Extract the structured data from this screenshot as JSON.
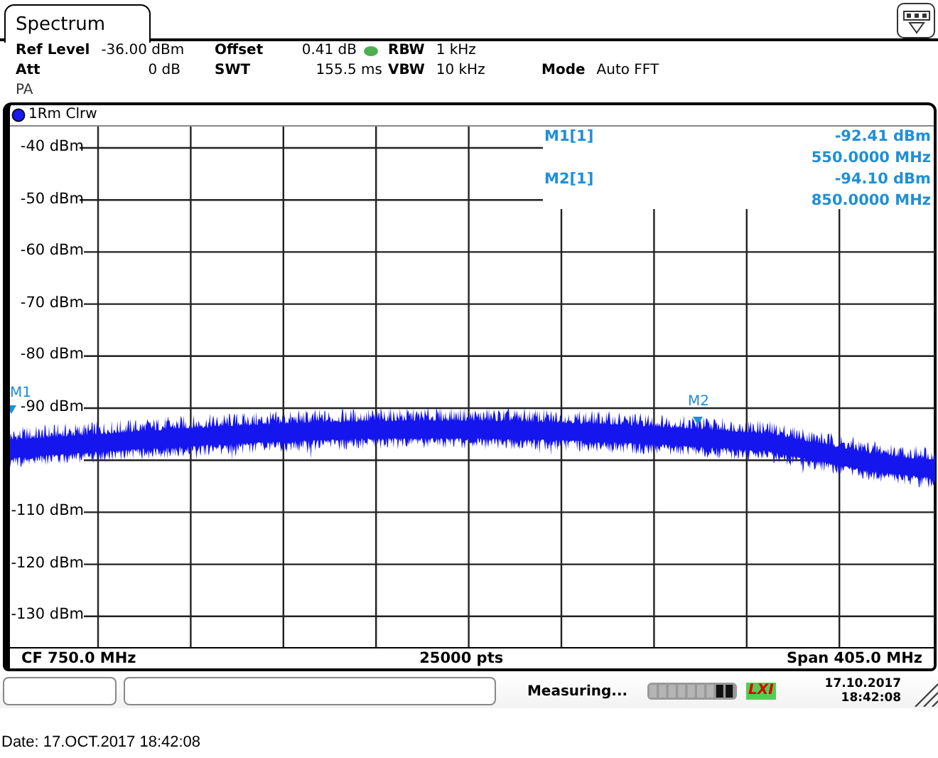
{
  "tab": {
    "label": "Spectrum",
    "selected": true
  },
  "settings": [
    [
      {
        "label": "Ref Level",
        "value": "-36.00 dBm"
      },
      {
        "label": "Offset",
        "value": "0.41 dB",
        "indicator": true
      },
      {
        "label": "RBW",
        "value": "1 kHz"
      }
    ],
    [
      {
        "label": "Att",
        "value": "0 dB"
      },
      {
        "label": "SWT",
        "value": "155.5 ms"
      },
      {
        "label": "VBW",
        "value": "10 kHz"
      },
      {
        "label": "Mode",
        "value": "Auto FFT"
      }
    ],
    [
      {
        "label": "PA"
      }
    ]
  ],
  "trace": {
    "label": "1Rm Clrw"
  },
  "y_axis_labels": [
    "-40 dBm",
    "-50 dBm",
    "-60 dBm",
    "-70 dBm",
    "-80 dBm",
    "-90 dBm",
    "-110 dBm",
    "-120 dBm",
    "-130 dBm"
  ],
  "marker_table": [
    {
      "name": "M1[1]",
      "level": "-92.41 dBm",
      "frequency": "550.0000 MHz"
    },
    {
      "name": "M2[1]",
      "level": "-94.10 dBm",
      "frequency": "850.0000 MHz"
    }
  ],
  "marker_flags": [
    "M1",
    "M2"
  ],
  "footer": {
    "center_frequency": "CF 750.0 MHz",
    "points": "25000 pts",
    "span": "Span 405.0 MHz"
  },
  "status_bar": {
    "message": "Measuring...",
    "logo": "LXI",
    "date": "17.10.2017",
    "time": "18:42:08"
  },
  "caption": "Date: 17.OCT.2017  18:42:08"
}
